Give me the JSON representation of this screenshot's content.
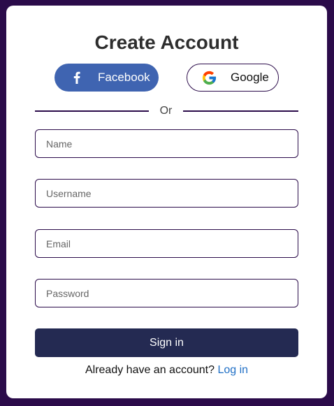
{
  "form": {
    "title": "Create Account",
    "divider_text": "Or",
    "submit_label": "Sign in",
    "footer_text": "Already have an account?",
    "footer_link": "Log in"
  },
  "social": {
    "facebook": {
      "label": "Facebook",
      "icon": "facebook-icon",
      "color": "#3f64b1"
    },
    "google": {
      "label": "Google",
      "icon": "google-icon"
    }
  },
  "fields": {
    "name": {
      "value": "",
      "placeholder": "Name"
    },
    "username": {
      "value": "",
      "placeholder": "Username"
    },
    "email": {
      "value": "",
      "placeholder": "Email"
    },
    "password": {
      "value": "",
      "placeholder": "Password"
    }
  },
  "colors": {
    "background": "#2b0b4a",
    "card": "#ffffff",
    "submit": "#242a52",
    "link": "#1f6fc5"
  }
}
